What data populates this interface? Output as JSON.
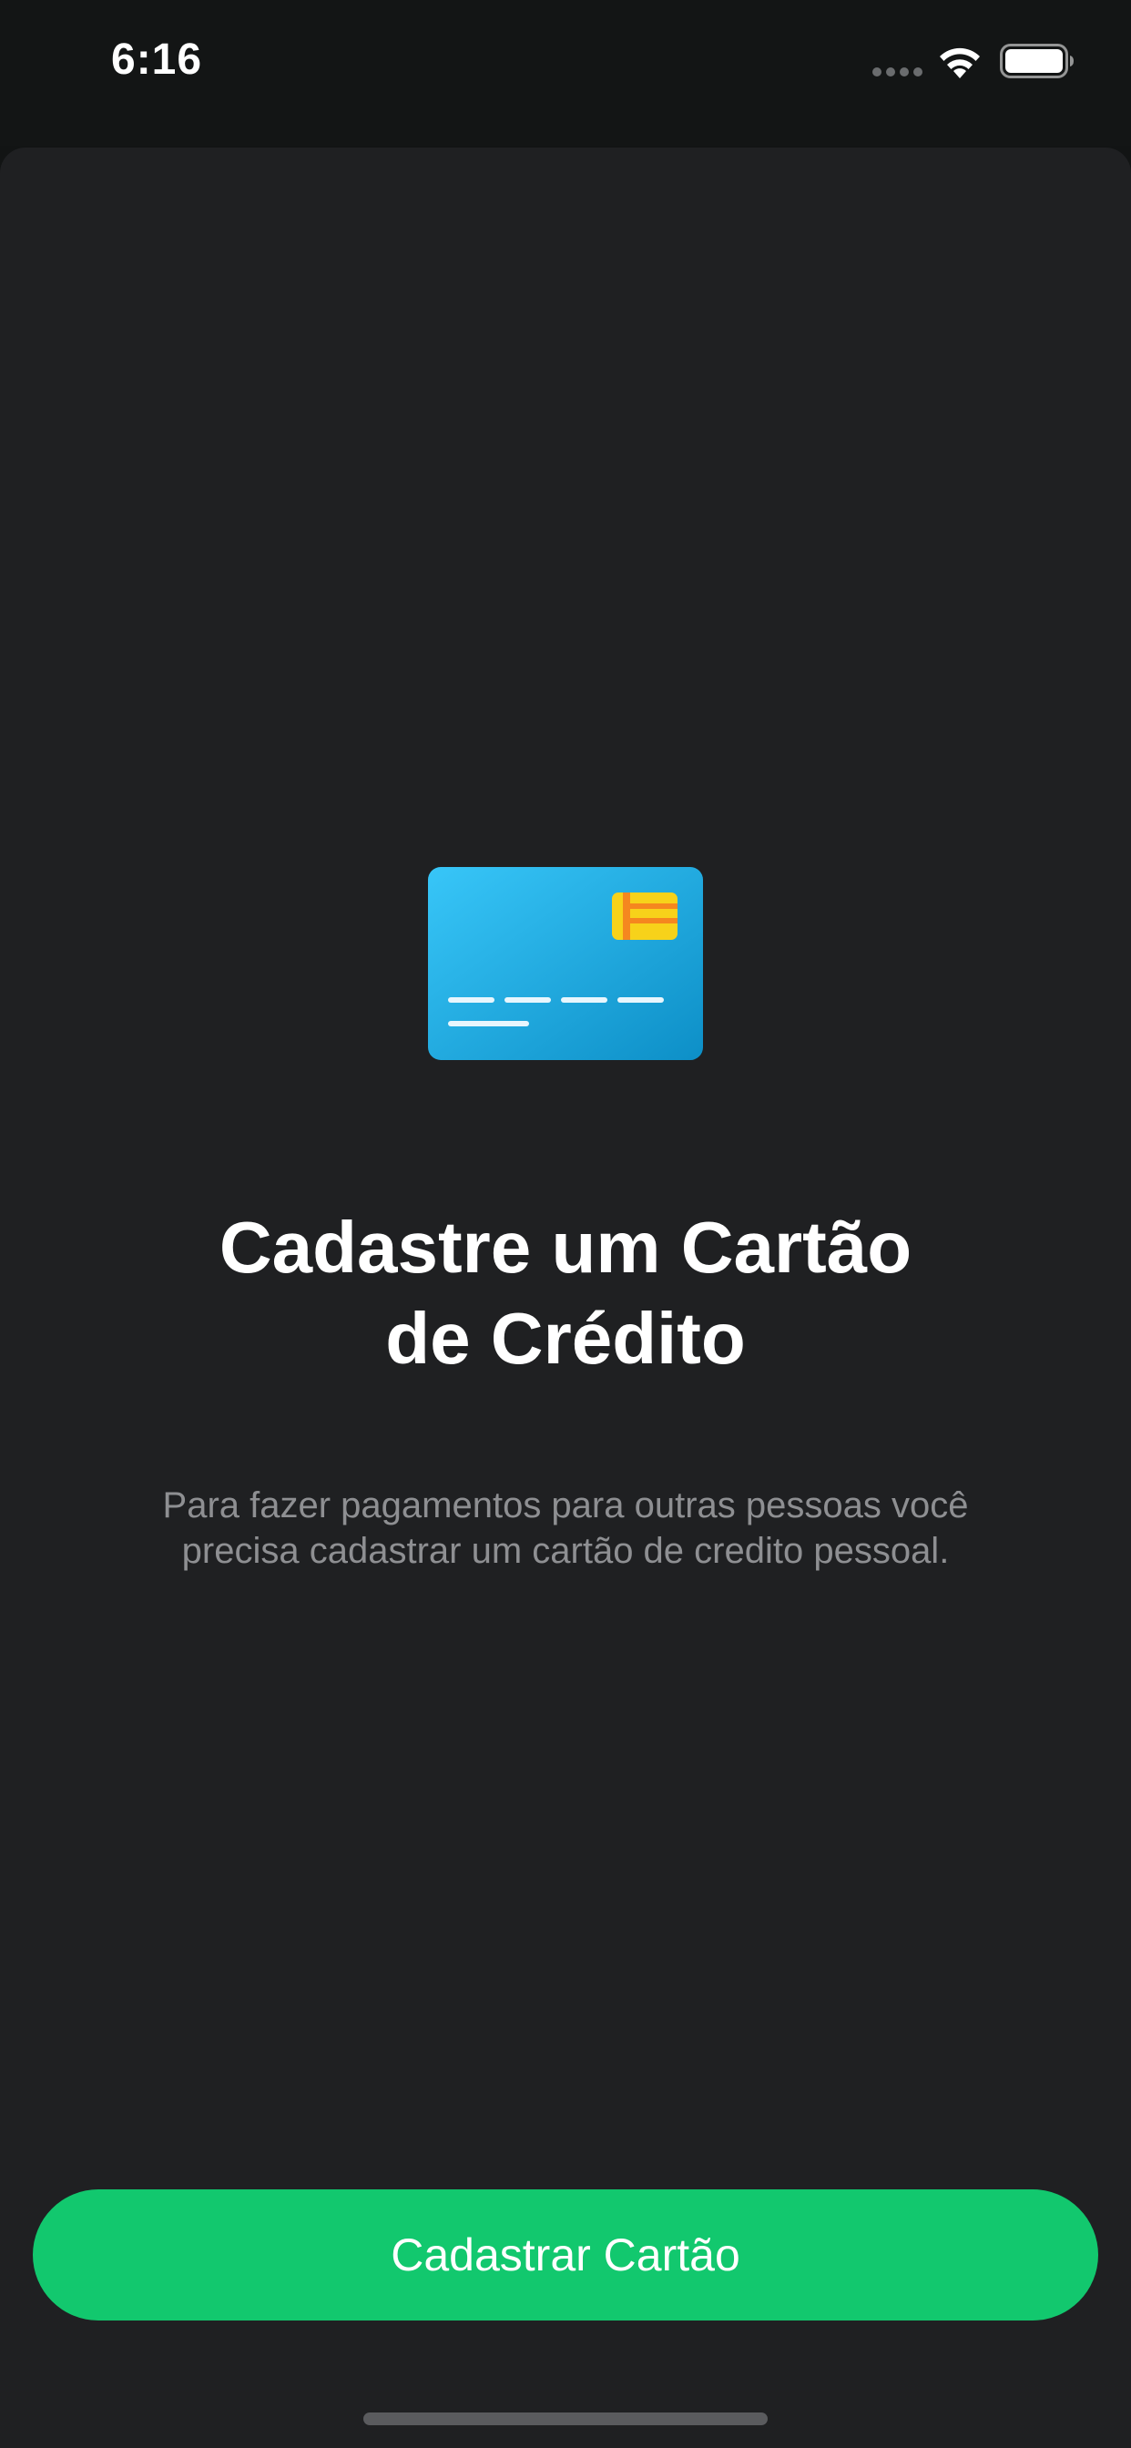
{
  "status_bar": {
    "time": "6:16",
    "wifi_icon": "wifi-icon",
    "battery_icon": "battery-full-icon",
    "signal_icon": "signal-dots-icon"
  },
  "onboarding": {
    "illustration_icon": "credit-card-icon",
    "title_line1": "Cadastre um Cartão",
    "title_line2": "de Crédito",
    "description_line1": "Para fazer pagamentos para outras pessoas você",
    "description_line2": "precisa cadastrar um cartão de credito pessoal.",
    "button_label": "Cadastrar Cartão"
  },
  "colors": {
    "background": "#1f2022",
    "status_bar": "#131515",
    "accent": "#12c86e",
    "card_blue": "#2eb8ee",
    "chip_yellow": "#f7d21a",
    "chip_orange": "#f5871f",
    "muted_text": "#8e8f92"
  }
}
